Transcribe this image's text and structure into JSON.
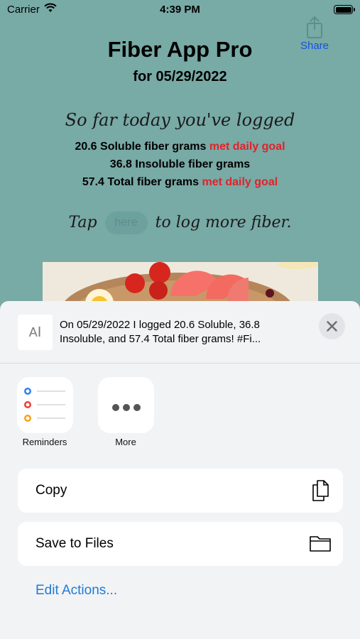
{
  "status_bar": {
    "carrier": "Carrier",
    "time": "4:39 PM"
  },
  "share": {
    "label": "Share",
    "icon": "share-icon"
  },
  "app": {
    "title": "Fiber App Pro",
    "date_line": "for 05/29/2022",
    "so_far": "So far today you've logged",
    "stats": [
      {
        "text": "20.6 Soluble fiber grams",
        "goal": "met daily goal"
      },
      {
        "text": "36.8 Insoluble fiber grams",
        "goal": ""
      },
      {
        "text": "57.4 Total fiber grams",
        "goal": "met daily goal"
      }
    ],
    "tap_prefix": "Tap",
    "here_label": "here",
    "tap_suffix": "to log more fiber.",
    "goal_color": "#e0232b",
    "background_color": "#78aaa6"
  },
  "share_sheet": {
    "preview_text": "On 05/29/2022 I logged  20.6 Soluble, 36.8 Insoluble, and 57.4 Total fiber grams!  #Fi...",
    "preview_icon": "text-document-icon",
    "close_icon": "close-icon",
    "apps": [
      {
        "label": "Reminders",
        "icon": "reminders-icon"
      },
      {
        "label": "More",
        "icon": "more-icon"
      }
    ],
    "actions": [
      {
        "label": "Copy",
        "icon": "copy-icon"
      },
      {
        "label": "Save to Files",
        "icon": "folder-icon"
      }
    ],
    "edit_actions": "Edit Actions..."
  }
}
